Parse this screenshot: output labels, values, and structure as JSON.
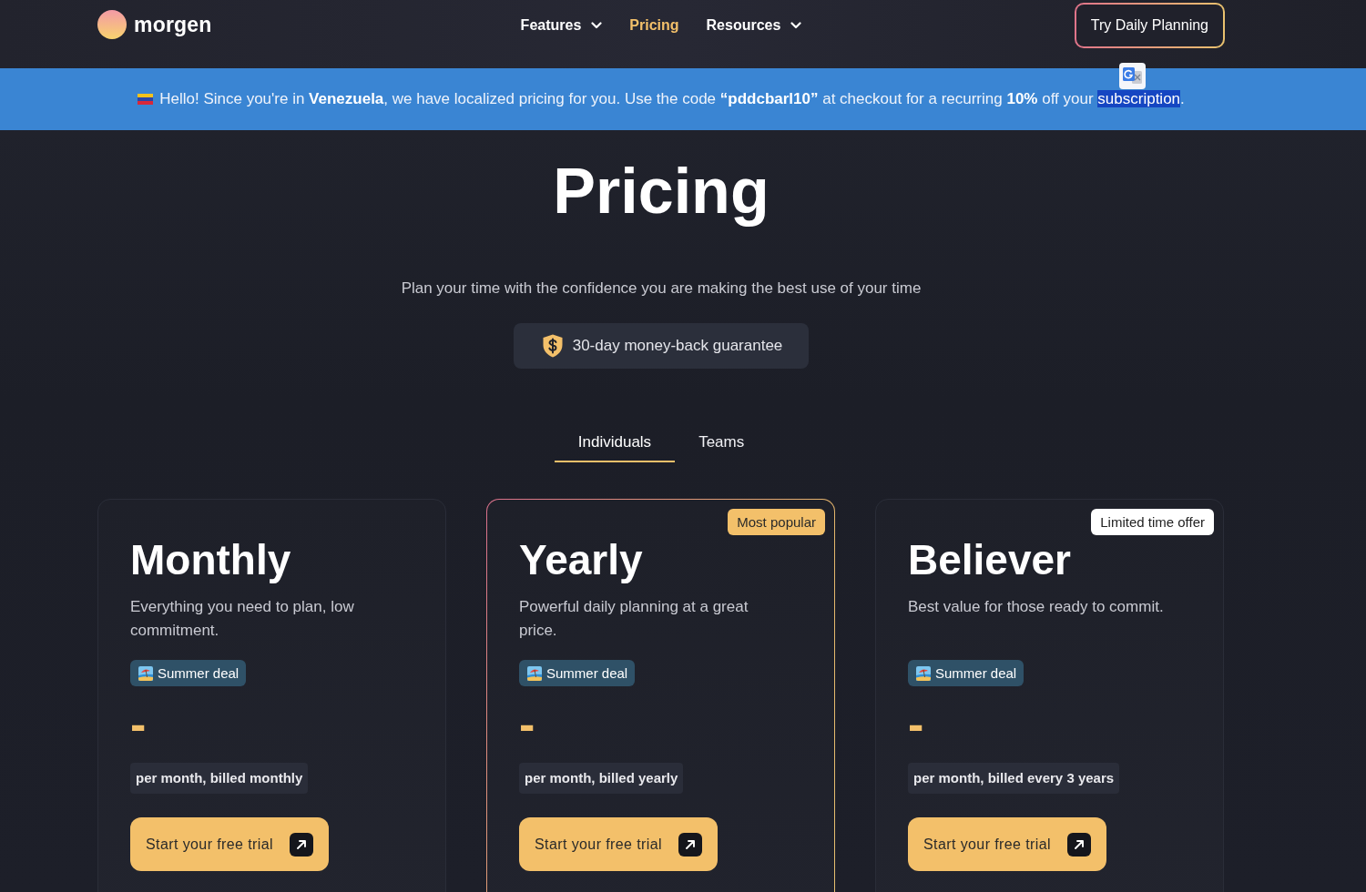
{
  "nav": {
    "logo": "morgen",
    "items": [
      {
        "label": "Features",
        "selected": false,
        "dropdown": true
      },
      {
        "label": "Pricing",
        "selected": true,
        "dropdown": false
      },
      {
        "label": "Resources",
        "selected": false,
        "dropdown": true
      }
    ],
    "cta": "Try Daily Planning"
  },
  "banner": {
    "message": "Hello! Since you're in **Venezuela**, we have localized pricing for you. Use the code **“pddcbarl10”** at checkout for a recurring **10%** off your",
    "highlighted": "subscription",
    "end": "."
  },
  "hero": {
    "title": "Pricing",
    "subtitle": "Plan your time with the confidence you are making the best use of your time",
    "guarantee": "30-day money-back guarantee"
  },
  "tabs": [
    {
      "label": "Individuals",
      "selected": true
    },
    {
      "label": "Teams",
      "selected": false
    }
  ],
  "plans": [
    {
      "name": "Monthly",
      "description": "Everything you need to plan, low commitment.",
      "featured": false,
      "deal": "Summer deal",
      "price": "-",
      "billing": "per month, billed monthly",
      "cta": "Start your free trial"
    },
    {
      "name": "Yearly",
      "description": "Powerful daily planning at a great price.",
      "featured": true,
      "badge": {
        "label": "Most popular",
        "kind": "accent"
      },
      "deal": "Summer deal",
      "price": "-",
      "billing": "per month, billed yearly",
      "cta": "Start your free trial"
    },
    {
      "name": "Believer",
      "description": "Best value for those ready to commit.",
      "featured": false,
      "badge": {
        "label": "Limited time offer",
        "kind": "light"
      },
      "deal": "Summer deal",
      "price": "-",
      "billing": "per month, billed every 3 years",
      "cta": "Start your free trial"
    }
  ]
}
